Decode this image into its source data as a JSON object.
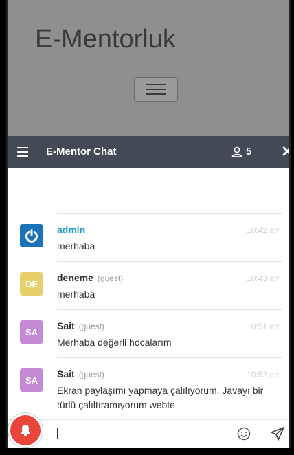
{
  "site": {
    "title": "E-Mentorluk"
  },
  "chat": {
    "title": "E-Mentor Chat",
    "user_count": "5",
    "close_label": "✕",
    "messages": [
      {
        "initials": "",
        "name": "admin",
        "tag": "",
        "time": "10:42 am",
        "text": "merhaba",
        "avatar_color": "#1a73b8",
        "name_color": "#1a9bc8"
      },
      {
        "initials": "DE",
        "name": "deneme",
        "tag": "(guest)",
        "time": "10:43 am",
        "text": "merhaba",
        "avatar_color": "#e7cf6b",
        "name_color": "#333333"
      },
      {
        "initials": "SA",
        "name": "Sait",
        "tag": "(guest)",
        "time": "10:51 am",
        "text": "Merhaba değerli hocalarım",
        "avatar_color": "#c58ad6",
        "name_color": "#333333"
      },
      {
        "initials": "SA",
        "name": "Sait",
        "tag": "(guest)",
        "time": "10:52 am",
        "text": "Ekran paylaşımı yapmaya çalılıyorum. Javayı bir türlü çalıltıramıyorum webte",
        "avatar_color": "#c58ad6",
        "name_color": "#333333"
      }
    ]
  },
  "colors": {
    "header_bg": "#444a55",
    "notify": "#e8453c"
  }
}
